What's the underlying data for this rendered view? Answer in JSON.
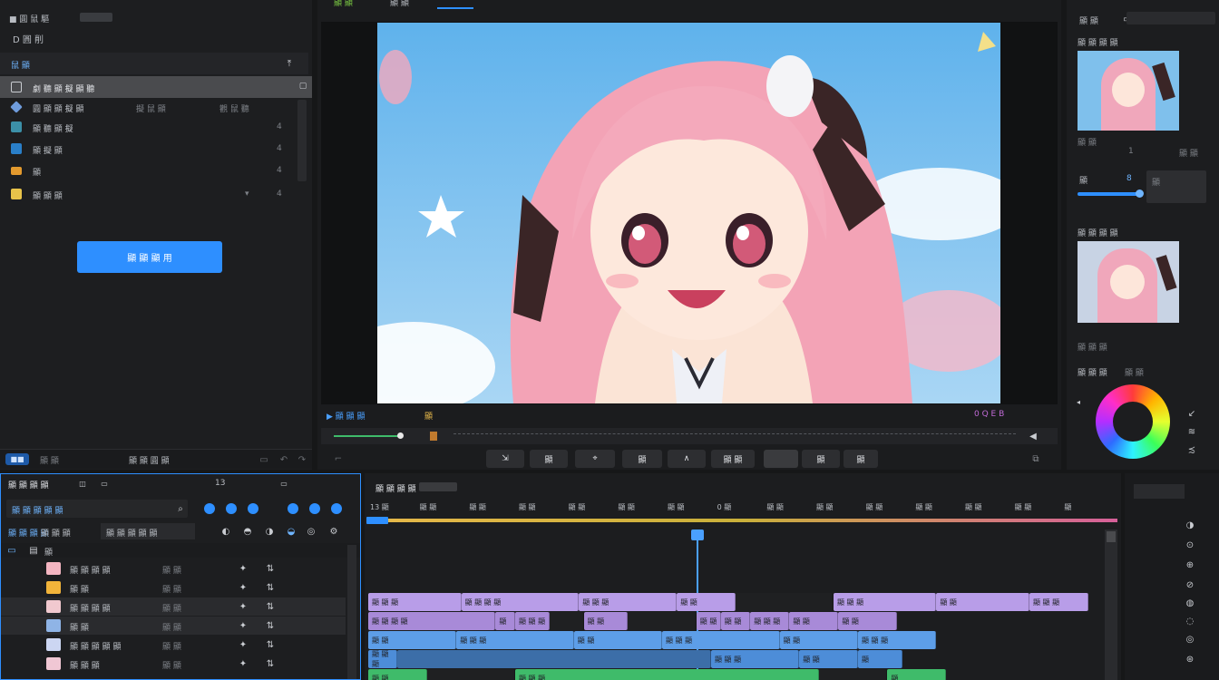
{
  "left_panel": {
    "top_title": "■ 圓 鼠 驅",
    "sub_title": "D 圓 削",
    "section_title": "鼠 顯",
    "items": [
      {
        "label": "劇 聽 顯 擬 顯 聽",
        "extra": "",
        "count": ""
      },
      {
        "label": "圓 顯 顯 擬 顯",
        "extra": "擬 鼠 顯",
        "count": "觀 鼠 聽"
      },
      {
        "label": "顯 聽 顯 擬",
        "extra": "",
        "count": "4"
      },
      {
        "label": "顯 擬 顯",
        "extra": "",
        "count": "4"
      },
      {
        "label": "顯",
        "extra": "",
        "count": "4"
      },
      {
        "label": "顯 顯 顯",
        "extra": "▾",
        "count": "4"
      }
    ],
    "primary_button": "顯 顯 顯 用",
    "footer_left": "顯 顯",
    "footer_mid": "顯 顯 圓 顯"
  },
  "preview": {
    "tabs": [
      "顯 顯",
      "顯 顯",
      ""
    ],
    "status_left": "▶ 顯 顯 顯",
    "status_mid": "顯",
    "status_right": "0 Q E B",
    "tools": [
      "⇲",
      "顯",
      "⌖",
      "顯",
      "∧",
      "顯 顯",
      "",
      "顯",
      "顯"
    ]
  },
  "right_panel": {
    "top": "顯 顯",
    "thumb1_title": "顯 顯 顯 顯",
    "thumb1_meta": [
      "顯 顯",
      "1",
      "顯 顯"
    ],
    "slider_label": "顯",
    "slider_value": "8",
    "box_label": "顯",
    "thumb2_title": "顯 顯 顯 顯",
    "thumb2_meta": "顯 顯 顯",
    "color_label": "顯 顯 顯",
    "color_value": "顯 顯",
    "side_icons": [
      "↙",
      "≋",
      "≾"
    ]
  },
  "media": {
    "tab_active": "顯 顯 顯 顯",
    "tab_number": "13",
    "search_placeholder": "顯 顯 顯 顯 顯",
    "filter_tabs": [
      "顯 顯 顯 顯",
      "顯 顯 顯",
      "顯 顯 顯 顯 顯"
    ],
    "column_header": "顯",
    "rows": [
      {
        "name": "顯 顯 顯 顯",
        "meta": "顯 顯",
        "thumb": "#f4b6c2"
      },
      {
        "name": "顯 顯",
        "meta": "顯 顯",
        "thumb": "#f2b43a"
      },
      {
        "name": "顯 顯 顯 顯",
        "meta": "顯 顯",
        "thumb": "#f1c9cf"
      },
      {
        "name": "顯 顯",
        "meta": "顯 顯",
        "thumb": "#8fb4e6"
      },
      {
        "name": "顯 顯 顯 顯 顯",
        "meta": "顯 顯",
        "thumb": "#ccd6f2"
      },
      {
        "name": "顯 顯 顯",
        "meta": "顯 顯",
        "thumb": "#f0c7d4"
      }
    ]
  },
  "timeline": {
    "title": "顯 顯 顯 顯",
    "ruler": [
      "13 顯",
      "顯 顯",
      "顯 顯",
      "顯 顯",
      "顯 顯",
      "顯 顯",
      "顯 顯",
      "0 顯",
      "顯 顯",
      "顯 顯",
      "顯 顯",
      "顯 顯",
      "顯 顯",
      "顯 顯",
      "顯"
    ],
    "tracks": [
      [
        {
          "label": "顯 顯 顯",
          "color": "#b89de8",
          "s": 0,
          "e": 19
        },
        {
          "label": "顯 顯 顯 顯",
          "color": "#b89de8",
          "s": 19,
          "e": 43
        },
        {
          "label": "顯 顯 顯",
          "color": "#b89de8",
          "s": 43,
          "e": 63
        },
        {
          "label": "顯 顯",
          "color": "#b89de8",
          "s": 63,
          "e": 75
        },
        {
          "label": "",
          "color": "#1f2022",
          "s": 75,
          "e": 95
        },
        {
          "label": "顯 顯 顯",
          "color": "#b89de8",
          "s": 95,
          "e": 116
        },
        {
          "label": "顯 顯",
          "color": "#b89de8",
          "s": 116,
          "e": 135
        },
        {
          "label": "顯 顯 顯",
          "color": "#b89de8",
          "s": 135,
          "e": 147
        }
      ],
      [
        {
          "label": "顯 顯 顯 顯",
          "color": "#a88ad8",
          "s": 0,
          "e": 26
        },
        {
          "label": "顯",
          "color": "#a88ad8",
          "s": 26,
          "e": 30
        },
        {
          "label": "顯 顯 顯",
          "color": "#a88ad8",
          "s": 30,
          "e": 37
        },
        {
          "label": "",
          "color": "#1f2022",
          "s": 37,
          "e": 44
        },
        {
          "label": "顯 顯",
          "color": "#a88ad8",
          "s": 44,
          "e": 53
        },
        {
          "label": "",
          "color": "#1f2022",
          "s": 53,
          "e": 67
        },
        {
          "label": "顯 顯",
          "color": "#a88ad8",
          "s": 67,
          "e": 72
        },
        {
          "label": "顯 顯",
          "color": "#a88ad8",
          "s": 72,
          "e": 78
        },
        {
          "label": "顯 顯 顯",
          "color": "#a88ad8",
          "s": 78,
          "e": 86
        },
        {
          "label": "顯 顯",
          "color": "#a88ad8",
          "s": 86,
          "e": 96
        },
        {
          "label": "顯 顯",
          "color": "#a88ad8",
          "s": 96,
          "e": 108
        }
      ],
      [
        {
          "label": "顯 顯",
          "color": "#5d9ee8",
          "s": 0,
          "e": 18
        },
        {
          "label": "顯 顯 顯",
          "color": "#5d9ee8",
          "s": 18,
          "e": 42
        },
        {
          "label": "顯 顯",
          "color": "#5d9ee8",
          "s": 42,
          "e": 60
        },
        {
          "label": "顯 顯 顯",
          "color": "#5d9ee8",
          "s": 60,
          "e": 84
        },
        {
          "label": "顯 顯",
          "color": "#5d9ee8",
          "s": 84,
          "e": 100
        },
        {
          "label": "顯 顯 顯",
          "color": "#5d9ee8",
          "s": 100,
          "e": 116
        }
      ],
      [
        {
          "label": "顯 顯 顯",
          "color": "#4d8dd8",
          "s": 0,
          "e": 6
        },
        {
          "label": "",
          "color": "#3c6ea8",
          "s": 6,
          "e": 70
        },
        {
          "label": "顯 顯 顯",
          "color": "#4d8dd8",
          "s": 70,
          "e": 88
        },
        {
          "label": "顯 顯",
          "color": "#4d8dd8",
          "s": 88,
          "e": 100
        },
        {
          "label": "顯",
          "color": "#4d8dd8",
          "s": 100,
          "e": 109
        }
      ],
      [
        {
          "label": "顯 顯",
          "color": "#3fbb6a",
          "s": 0,
          "e": 12
        },
        {
          "label": "",
          "color": "#1f2022",
          "s": 12,
          "e": 30
        },
        {
          "label": "顯 顯 顯",
          "color": "#3fbb6a",
          "s": 30,
          "e": 92
        },
        {
          "label": "",
          "color": "#1f2022",
          "s": 92,
          "e": 106
        },
        {
          "label": "顯",
          "color": "#3fbb6a",
          "s": 106,
          "e": 118
        }
      ]
    ]
  },
  "colors": {
    "accent": "#2e8fff",
    "ruler_gradient": [
      "#e6b84a",
      "#d6609a"
    ]
  }
}
